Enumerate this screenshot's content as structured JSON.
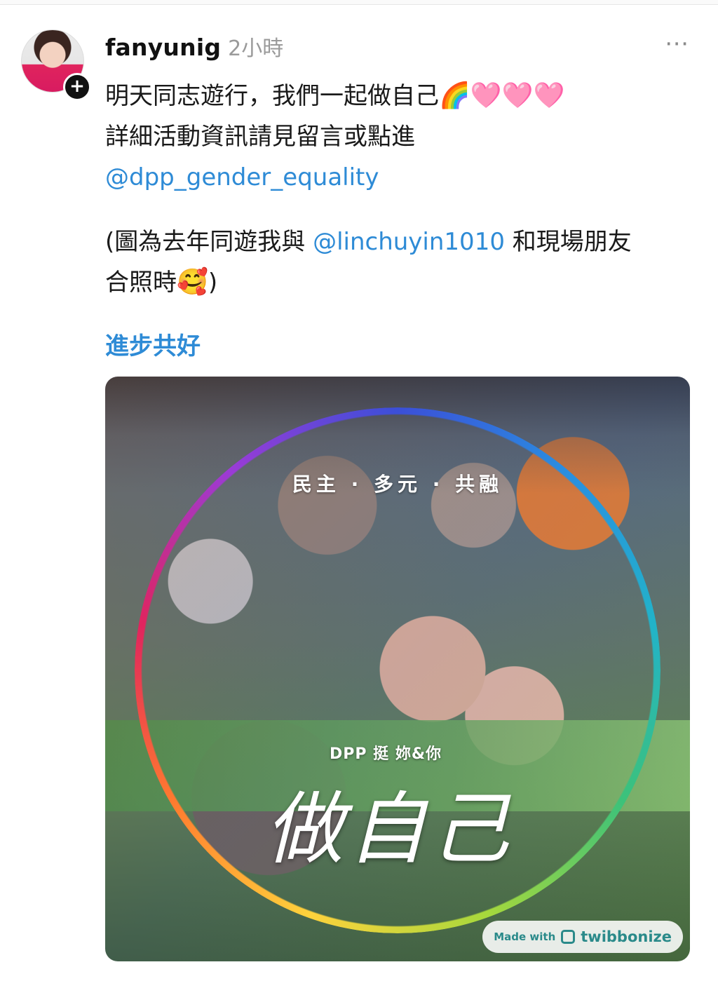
{
  "post": {
    "username": "fanyunig",
    "timestamp": "2小時",
    "more_icon": "⋯",
    "follow_icon": "+",
    "lines": {
      "l1_text": "明天同志遊行，我們一起做自己",
      "l1_emoji": "🌈🩷🩷🩷",
      "l2": "詳細活動資訊請見留言或點進",
      "l3_mention": "@dpp_gender_equality",
      "l4_pre": "(圖為去年同遊我與 ",
      "l4_mention": "@linchuyin1010",
      "l4_post": " 和現場朋友",
      "l5_text": "合照時",
      "l5_emoji": "🥰",
      "l5_end": ")"
    },
    "hashtag": "進步共好"
  },
  "image": {
    "motto": "民主 · 多元 · 共融",
    "campaign_sub": "DPP 挺 妳&你",
    "campaign_title": "做自己",
    "watermark_made": "Made with",
    "watermark_brand": "twibbonize"
  },
  "colors": {
    "link": "#2e8bd6",
    "timestamp": "#9a9a9a",
    "watermark": "#2a8a8a"
  }
}
